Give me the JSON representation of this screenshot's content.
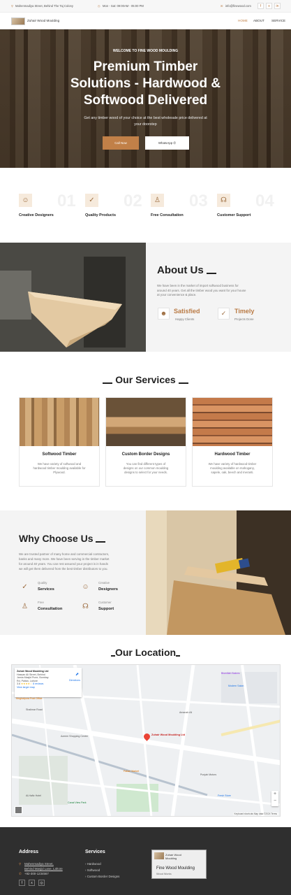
{
  "topbar": {
    "address": "Mahenmadiya Street, Behind The Taj Colony",
    "phone": "Mon - Sat: 09:00AM - 05:00 PM",
    "email": "info@finewood.com",
    "social_icons": [
      "facebook-icon",
      "twitter-icon",
      "linkedin-icon"
    ]
  },
  "header": {
    "logo_text": "Zuhair Wood Moulding",
    "nav": [
      "HOME",
      "ABOUT",
      "SERVICE"
    ],
    "active_color": "#c18048"
  },
  "hero": {
    "kicker": "WELCOME TO FINE WOOD MOULDING",
    "title_line1": "Premium Timber",
    "title_line2": "Solutions - Hardwood &",
    "title_line3": "Softwood Delivered",
    "subtitle_line1": "Get any timber wood of your choice at the best wholesale price delivered at",
    "subtitle_line2": "your doorstep",
    "btn_call": "Call Now",
    "btn_whatsapp": "WhatsApp"
  },
  "features": [
    {
      "num": "01",
      "label": "Creative Designers",
      "icon": "designer-icon"
    },
    {
      "num": "02",
      "label": "Quality Products",
      "icon": "check-icon"
    },
    {
      "num": "03",
      "label": "Free Consultation",
      "icon": "consultation-icon"
    },
    {
      "num": "04",
      "label": "Customer Support",
      "icon": "headset-icon"
    }
  ],
  "about": {
    "title": "About Us",
    "text_line1": "We have been in the market of import softwood business for",
    "text_line2": "around 40 years. Get all the timber wood you want for your house",
    "text_line3": "at your convenience & place.",
    "stat1_title": "Satisfied",
    "stat1_sub": "Happy Clients",
    "stat2_title": "Timely",
    "stat2_sub": "Projects Done"
  },
  "services": {
    "title": "Our Services",
    "cards": [
      {
        "title": "Softwood Timber",
        "line1": "We have variety of softwood and",
        "line2": "hardwood timber moulding available for",
        "line3": "Plywood."
      },
      {
        "title": "Custom Border Designs",
        "line1": "You can find different types of",
        "line2": "designs on our common moulding",
        "line3": "designs to select for your needs."
      },
      {
        "title": "Hardwood Timber",
        "line1": "We have variety of hardwood timber",
        "line2": "moulding available on mahogany,",
        "line3": "sapele, oak, beech and meranti."
      }
    ]
  },
  "why": {
    "title": "Why Choose Us",
    "text_line1": "We are trusted partner of many home and commercial contractors,",
    "text_line2": "banks and many more. We have been serving in the timber market",
    "text_line3": "for around 40 years. You can rest assured your project is in hands",
    "text_line4": "we will get them delivered from the best timber distributors to you.",
    "items": [
      {
        "small": "Quality",
        "big": "Services"
      },
      {
        "small": "Creative",
        "big": "Designers"
      },
      {
        "small": "Free",
        "big": "Consultation"
      },
      {
        "small": "Customer",
        "big": "Support"
      }
    ]
  },
  "location": {
    "title": "Our Location",
    "map_card_title": "Zuhair Wood Moulding Ltd",
    "map_card_line1": "Hassan Ali Street, Behind",
    "map_card_line2": "Jamia Masjid Pune, Bombay",
    "map_card_line3": "Rd, Paltan, Lahore",
    "map_card_rating": "3.6",
    "map_card_reviews": "8 reviews",
    "map_card_link": "View larger map",
    "map_directions": "Directions",
    "map_pin_label": "Zuhair Wood Moulding Ltd",
    "map_places": [
      "Mughalpura Post Office",
      "Bismillah Bakers",
      "Modern Salon",
      "Shalimar Road",
      "Azeem Shopping Center",
      "Amanah Ali",
      "Paltan Market",
      "Al-Hafiz Hotel",
      "Punjab Motors",
      "Fresh Store",
      "Canal View Park"
    ],
    "map_footer": "Keyboard shortcuts   Map data ©2024   Terms"
  },
  "footer": {
    "address_title": "Address",
    "address_line1": "Mahenmadiya Street,",
    "address_line2": "Behind Masjid Lane, Lahore",
    "phone": "+92-300-1234567",
    "services_title": "Services",
    "services": [
      "Hardwood",
      "Softwood",
      "Custom Border Designs"
    ],
    "card_logo": "Zuhair Wood",
    "card_sub": "Moulding",
    "card_name": "Fine Wood Moulding",
    "card_small": "Wood Works"
  }
}
